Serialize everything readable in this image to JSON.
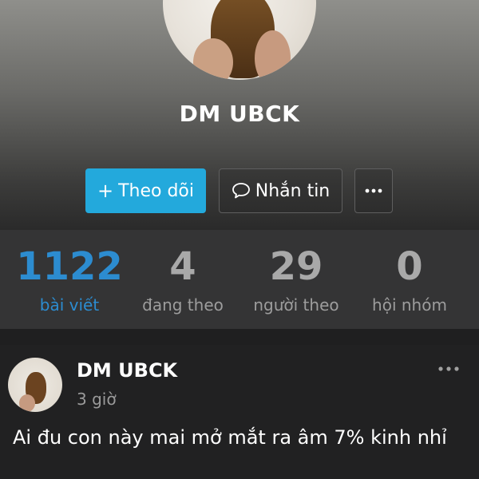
{
  "profile": {
    "name": "DM UBCK",
    "actions": {
      "follow_label": "Theo dõi",
      "message_label": "Nhắn tin"
    }
  },
  "stats": [
    {
      "value": "1122",
      "label": "bài viết"
    },
    {
      "value": "4",
      "label": "đang theo"
    },
    {
      "value": "29",
      "label": "người theo"
    },
    {
      "value": "0",
      "label": "hội nhóm"
    }
  ],
  "post": {
    "author": "DM UBCK",
    "time": "3 giờ",
    "text": "Ai đu con này mai mở mắt ra âm 7% kinh nhỉ"
  },
  "colors": {
    "accent": "#23a9dc",
    "stat_active": "#2c8cd0"
  },
  "icons": {
    "plus": "plus-icon",
    "message": "speech-bubble-icon",
    "more": "ellipsis-icon"
  }
}
